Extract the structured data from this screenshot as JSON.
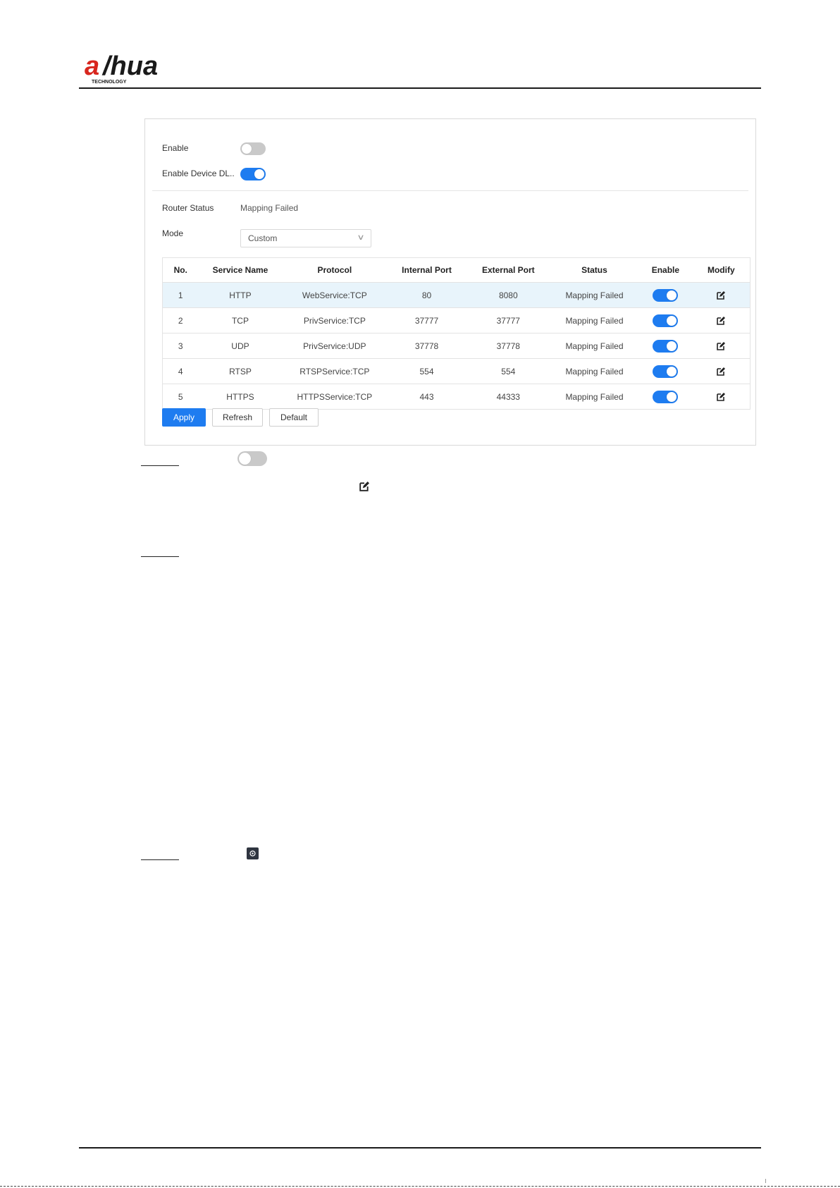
{
  "brand": {
    "logo_text": "alhua",
    "logo_sub": "TECHNOLOGY",
    "accent": "#1e7cf0",
    "logo_color": "#d8261e"
  },
  "settings": {
    "enable_label": "Enable",
    "enable_on": false,
    "dlna_label": "Enable Device DL..",
    "dlna_on": true,
    "router_status_label": "Router Status",
    "router_status_value": "Mapping Failed",
    "mode_label": "Mode",
    "mode_value": "Custom"
  },
  "table": {
    "headers": [
      "No.",
      "Service Name",
      "Protocol",
      "Internal Port",
      "External Port",
      "Status",
      "Enable",
      "Modify"
    ],
    "rows": [
      {
        "no": "1",
        "service": "HTTP",
        "protocol": "WebService:TCP",
        "internal": "80",
        "external": "8080",
        "status": "Mapping Failed",
        "enabled": true
      },
      {
        "no": "2",
        "service": "TCP",
        "protocol": "PrivService:TCP",
        "internal": "37777",
        "external": "37777",
        "status": "Mapping Failed",
        "enabled": true
      },
      {
        "no": "3",
        "service": "UDP",
        "protocol": "PrivService:UDP",
        "internal": "37778",
        "external": "37778",
        "status": "Mapping Failed",
        "enabled": true
      },
      {
        "no": "4",
        "service": "RTSP",
        "protocol": "RTSPService:TCP",
        "internal": "554",
        "external": "554",
        "status": "Mapping Failed",
        "enabled": true
      },
      {
        "no": "5",
        "service": "HTTPS",
        "protocol": "HTTPSService:TCP",
        "internal": "443",
        "external": "44333",
        "status": "Mapping Failed",
        "enabled": true
      }
    ]
  },
  "buttons": {
    "apply": "Apply",
    "refresh": "Refresh",
    "default": "Default"
  },
  "icons": {
    "edit": "edit-icon",
    "gear": "gear-icon",
    "chevron": "chevron-down-icon"
  }
}
